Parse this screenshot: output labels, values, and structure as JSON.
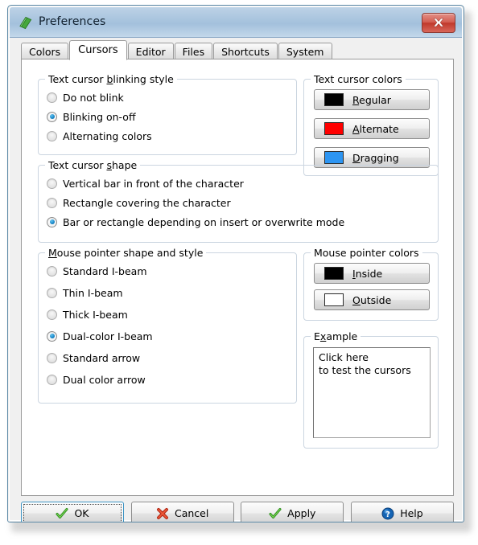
{
  "window": {
    "title": "Preferences",
    "icon": "application-icon",
    "close_label": "Close"
  },
  "tabs": [
    {
      "label": "Colors",
      "active": false
    },
    {
      "label": "Cursors",
      "active": true
    },
    {
      "label": "Editor",
      "active": false
    },
    {
      "label": "Files",
      "active": false
    },
    {
      "label": "Shortcuts",
      "active": false
    },
    {
      "label": "System",
      "active": false
    }
  ],
  "groups": {
    "blinking_style": {
      "title_before": "Text cursor ",
      "title_accel": "b",
      "title_after": "linking style",
      "options": [
        {
          "label": "Do not blink",
          "selected": false
        },
        {
          "label": "Blinking on-off",
          "selected": true
        },
        {
          "label": "Alternating colors",
          "selected": false
        }
      ]
    },
    "cursor_shape": {
      "title_before": "Text cursor ",
      "title_accel": "s",
      "title_after": "hape",
      "options": [
        {
          "label": "Vertical bar in front of the character",
          "selected": false
        },
        {
          "label": "Rectangle covering the character",
          "selected": false
        },
        {
          "label": "Bar or rectangle depending on insert or overwrite mode",
          "selected": true
        }
      ]
    },
    "pointer_shape": {
      "title_before": "",
      "title_accel": "M",
      "title_after": "ouse pointer shape and style",
      "options": [
        {
          "label": "Standard I-beam",
          "selected": false
        },
        {
          "label": "Thin I-beam",
          "selected": false
        },
        {
          "label": "Thick I-beam",
          "selected": false
        },
        {
          "label": "Dual-color I-beam",
          "selected": true
        },
        {
          "label": "Standard arrow",
          "selected": false
        },
        {
          "label": "Dual color arrow",
          "selected": false
        }
      ]
    },
    "cursor_colors": {
      "title_before": "Text cursor colors",
      "title_accel": "",
      "title_after": "",
      "buttons": [
        {
          "label_accel": "R",
          "label_rest": "egular",
          "color": "#000000"
        },
        {
          "label_accel": "A",
          "label_rest": "lternate",
          "color": "#ff0000"
        },
        {
          "label_accel": "D",
          "label_rest": "ragging",
          "color": "#2d95f2"
        }
      ]
    },
    "pointer_colors": {
      "title_before": "Mouse pointer colors",
      "title_accel": "",
      "title_after": "",
      "buttons": [
        {
          "label_accel": "I",
          "label_rest": "nside",
          "color": "#000000"
        },
        {
          "label_accel": "O",
          "label_rest": "utside",
          "color": "#ffffff"
        }
      ]
    },
    "example": {
      "title_before": "E",
      "title_accel": "x",
      "title_after": "ample",
      "line1": "Click here",
      "line2": "to test the cursors"
    }
  },
  "buttons": [
    {
      "label": "OK",
      "icon": "check-icon",
      "focused": true
    },
    {
      "label": "Cancel",
      "icon": "cross-icon",
      "focused": false
    },
    {
      "label": "Apply",
      "icon": "check-icon",
      "focused": false
    },
    {
      "label": "Help",
      "icon": "question-icon",
      "focused": false
    }
  ],
  "colors": {
    "titlebar_top": "#bdd2e6",
    "titlebar_bottom": "#c3d8ea",
    "close_red": "#c0392c",
    "radio_dot": "#1887c9",
    "window_border": "#5d8aa8",
    "group_border": "#cbd5e0",
    "page_bg": "#ffffff"
  }
}
